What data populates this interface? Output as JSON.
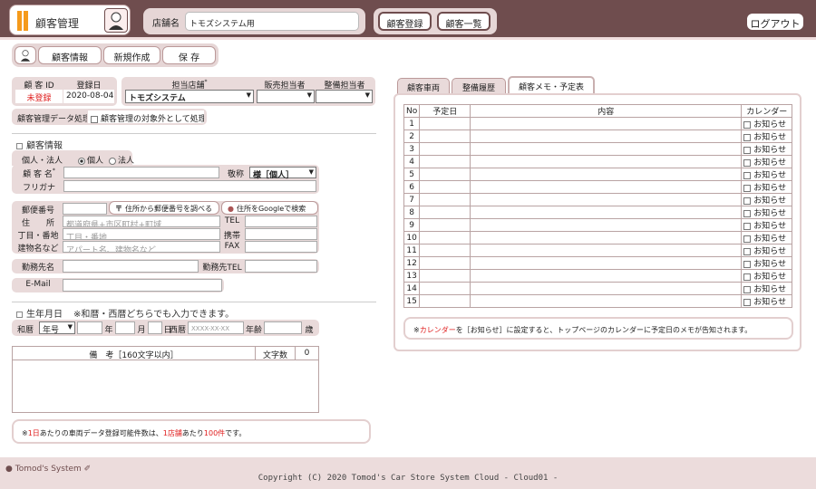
{
  "header": {
    "title": "顧客管理",
    "shop_label": "店舗名",
    "shop_value": "トモズシステム用",
    "register_button": "顧客登録",
    "list_button": "顧客一覧",
    "logout_button": "ログアウト"
  },
  "toolbar": {
    "customer_info": "顧客情報",
    "new": "新規作成",
    "save": "保 存"
  },
  "customer": {
    "id_label": "顧 客 ID",
    "id_value": "未登録",
    "reg_label": "登録日",
    "reg_value": "2020-08-04",
    "store_label": "担当店舗",
    "required_mark": "*",
    "store_value": "トモズシステム",
    "sales_label": "販売担当者",
    "maint_label": "整備担当者",
    "process_label": "顧客管理データ処理",
    "exclude_label": "顧客管理の対象外として処理"
  },
  "info": {
    "section": "顧客情報",
    "type_label": "個人・法人",
    "opt_person": "個人",
    "opt_corp": "法人",
    "name_label": "顧 客 名",
    "kana_label": "フリガナ",
    "honor_label": "敬称",
    "honor_value": "様［個人］"
  },
  "address": {
    "zip_label": "郵便番号",
    "zip_button": "住所から郵便番号を調べる",
    "google_button": "住所をGoogleで検索",
    "addr_label": "住　　所",
    "addr_ph": "都道府県+市区町村+町域",
    "chome_label": "丁目・番地",
    "chome_ph": "丁目・番地",
    "bldg_label": "建物名など",
    "bldg_ph": "アパート名、建物名など",
    "tel": "TEL",
    "mobile": "携帯",
    "fax": "FAX",
    "work_label": "勤務先名",
    "worktel_label": "勤務先TEL",
    "email_label": "E-Mail"
  },
  "birth": {
    "section": "生年月日",
    "note": "※和暦・西暦どちらでも入力できます。",
    "wareki": "和暦",
    "era": "年号",
    "year": "年",
    "month": "月",
    "day": "日",
    "seireki": "西暦",
    "seireki_ph": "XXXX-XX-XX",
    "age": "年齢",
    "age_unit": "歳"
  },
  "remarks": {
    "label": "備　考［160文字以内］",
    "count_label": "文字数",
    "count": "0"
  },
  "note_bottom": {
    "p1": "※",
    "p2": "1日",
    "p3": "あたりの車両データ登録可能件数は、",
    "p4": "1店舗",
    "p5": "あたり",
    "p6": "100件",
    "p7": "です。"
  },
  "tabs": [
    "顧客車両",
    "整備履歴",
    "顧客メモ・予定表"
  ],
  "memo": {
    "col_no": "No",
    "col_date": "予定日",
    "col_content": "内容",
    "col_cal": "カレンダー",
    "notify": "お知らせ",
    "rows": [
      "1",
      "2",
      "3",
      "4",
      "5",
      "6",
      "7",
      "8",
      "9",
      "10",
      "11",
      "12",
      "13",
      "14",
      "15"
    ]
  },
  "memo_note": {
    "p1": "※",
    "p2": "カレンダー",
    "p3": "を［お知らせ］に設定すると、トップページのカレンダーに予定日のメモが告知されます。"
  },
  "footer": {
    "brand": "Tomod's System",
    "copyright": "Copyright (C) 2020 Tomod's Car Store System Cloud - Cloud01 -"
  },
  "colors": {
    "header": "#6f4d4e",
    "accent": "#f59a1b",
    "panel": "#e9dada",
    "red": "#e02020"
  }
}
